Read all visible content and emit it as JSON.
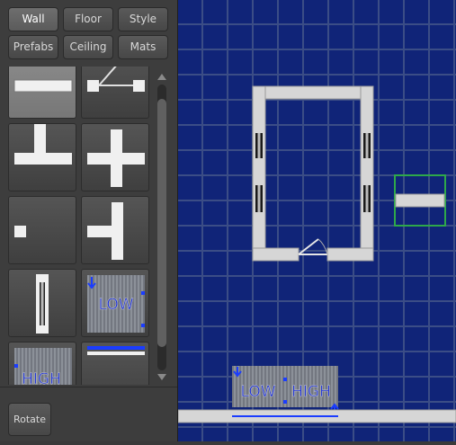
{
  "tabs": [
    {
      "label": "Wall",
      "active": true
    },
    {
      "label": "Floor",
      "active": false
    },
    {
      "label": "Style",
      "active": false
    },
    {
      "label": "Prefabs",
      "active": false
    },
    {
      "label": "Ceiling",
      "active": false
    },
    {
      "label": "Mats",
      "active": false
    }
  ],
  "palette": {
    "items": [
      {
        "name": "straight-wall",
        "selected": true
      },
      {
        "name": "door-wall",
        "selected": false
      },
      {
        "name": "corner-wall",
        "selected": false
      },
      {
        "name": "cross-wall",
        "selected": false
      },
      {
        "name": "pillar",
        "selected": false
      },
      {
        "name": "t-junction-wall",
        "selected": false
      },
      {
        "name": "window-wall",
        "selected": false
      },
      {
        "name": "low-wall",
        "label": "LOW",
        "selected": false
      },
      {
        "name": "high-wall",
        "label": "HIGH",
        "selected": false
      },
      {
        "name": "thin-wall",
        "selected": false
      }
    ]
  },
  "rotate_label": "Rotate",
  "viewport": {
    "grid_color": "#3b4d86",
    "background": "#102478",
    "low_label": "LOW",
    "high_label": "HIGH",
    "cursor_color": "#2ea84a"
  },
  "colors": {
    "accent": "#1a3cff",
    "wall": "#d6d6d6"
  }
}
